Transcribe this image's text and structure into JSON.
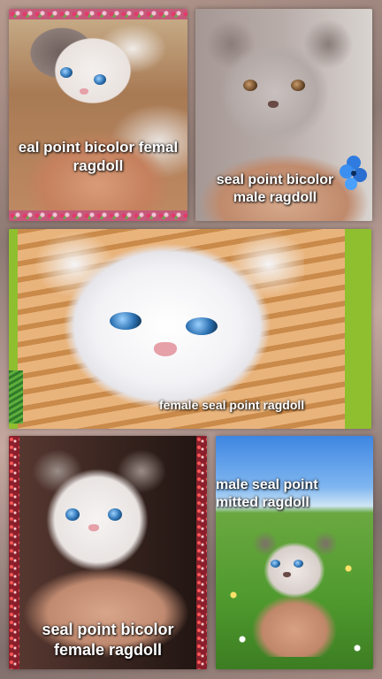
{
  "collage": {
    "panels": [
      {
        "id": "panel-1",
        "caption": "eal point bicolor femal\nragdoll"
      },
      {
        "id": "panel-2",
        "caption": "seal point bicolor\nmale  ragdoll"
      },
      {
        "id": "panel-3",
        "caption": "female seal point ragdoll"
      },
      {
        "id": "panel-4",
        "caption": "seal point bicolor\nfemale  ragdoll"
      },
      {
        "id": "panel-5",
        "caption": "male seal point\nmitted ragdoll"
      }
    ]
  },
  "icons": [
    "flower-icon"
  ],
  "colors": {
    "caption_text": "#ffffff",
    "panel3_green_frame": "#8fbf2f",
    "panel5_sky": "#4a8fe0",
    "panel5_meadow": "#5fa83a"
  }
}
